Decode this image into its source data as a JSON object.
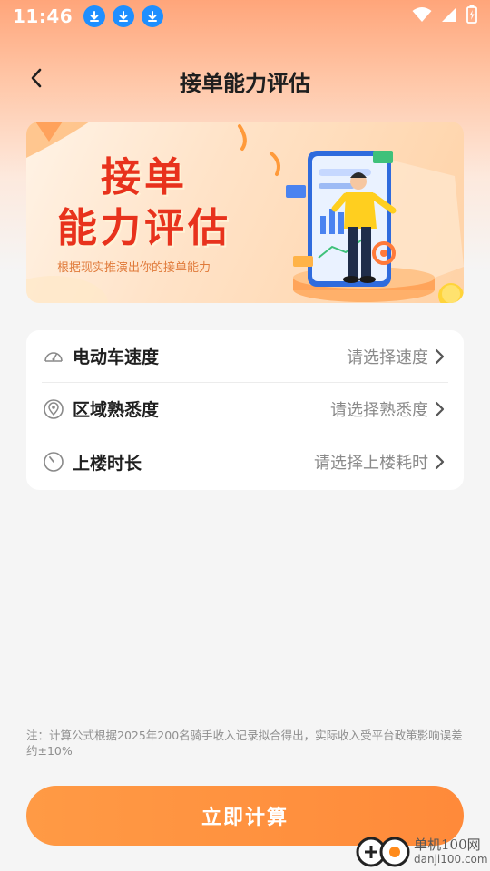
{
  "status_bar": {
    "time": "11:46",
    "icons": [
      "download-icon",
      "download-icon",
      "download-icon",
      "wifi-icon",
      "signal-icon",
      "battery-charging-icon"
    ]
  },
  "header": {
    "title": "接单能力评估",
    "back_icon": "chevron-left-icon"
  },
  "banner": {
    "title_line1": "接单",
    "title_line2": "能力评估",
    "subtitle": "根据现实推演出你的接单能力"
  },
  "settings": {
    "items": [
      {
        "icon": "speedometer-icon",
        "label": "电动车速度",
        "value": "请选择速度"
      },
      {
        "icon": "location-pin-icon",
        "label": "区域熟悉度",
        "value": "请选择熟悉度"
      },
      {
        "icon": "timer-icon",
        "label": "上楼时长",
        "value": "请选择上楼耗时"
      }
    ]
  },
  "note": "注：计算公式根据2025年200名骑手收入记录拟合得出，实际收入受平台政策影响误差约±10%",
  "cta": {
    "label": "立即计算"
  },
  "watermark": {
    "cn": "单机100网",
    "en": "danji100.com"
  },
  "colors": {
    "accent": "#ff8f3f",
    "banner_title": "#e8321c",
    "download_badge": "#1e8fff"
  }
}
